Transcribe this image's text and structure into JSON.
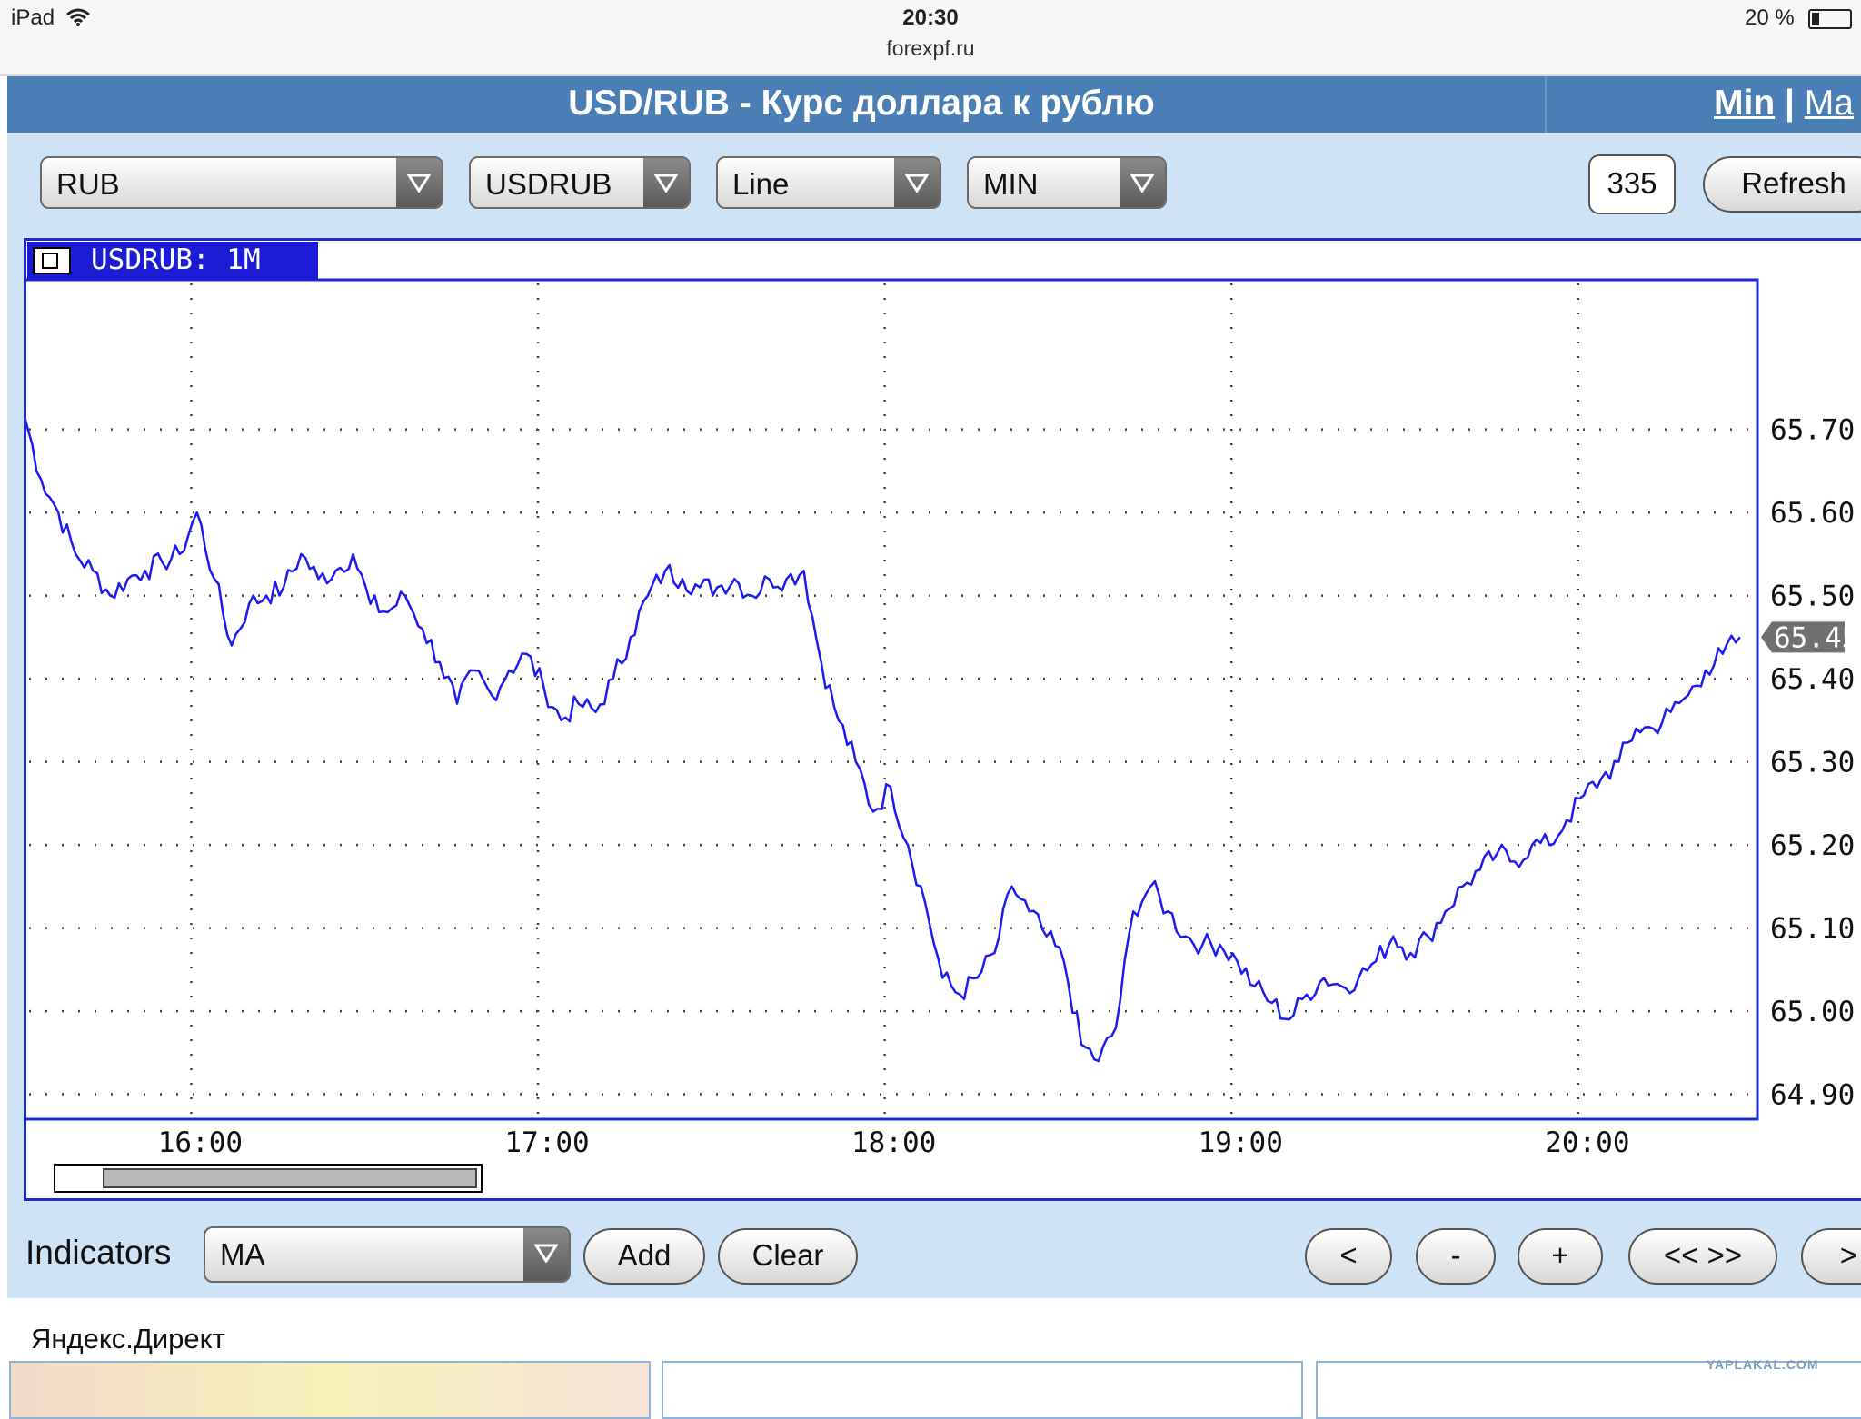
{
  "status_bar": {
    "device": "iPad",
    "time": "20:30",
    "url": "forexpf.ru",
    "battery": "20 %"
  },
  "header": {
    "title": "USD/RUB - Курс доллара к рублю",
    "link_min": "Min",
    "link_sep": " | ",
    "link_max_partial": "Ma"
  },
  "toolbar": {
    "currency_select": "RUB",
    "pair_select": "USDRUB",
    "type_select": "Line",
    "period_select": "MIN",
    "count_value": "335",
    "refresh_label": "Refresh"
  },
  "chart_tab": {
    "label": "USDRUB: 1M"
  },
  "chart_data": {
    "type": "line",
    "title": "USDRUB: 1M",
    "x_ticks": [
      "16:00",
      "17:00",
      "18:00",
      "19:00",
      "20:00"
    ],
    "y_ticks": [
      "64.90",
      "65.00",
      "65.10",
      "65.20",
      "65.30",
      "65.40",
      "65.50",
      "65.60",
      "65.70"
    ],
    "ylim": [
      64.87,
      65.88
    ],
    "xlim": [
      "15:31",
      "20:31"
    ],
    "current_value": "65.45",
    "grid": true,
    "series": [
      {
        "x": [
          "15:31",
          "15:34",
          "15:37",
          "15:40",
          "15:43",
          "15:46",
          "15:49",
          "15:52",
          "15:55",
          "15:58",
          "16:01",
          "16:04",
          "16:07",
          "16:10",
          "16:13",
          "16:16",
          "16:19",
          "16:22",
          "16:25",
          "16:28",
          "16:31",
          "16:34",
          "16:37",
          "16:40",
          "16:43",
          "16:46",
          "16:49",
          "16:52",
          "16:55",
          "16:58",
          "17:01",
          "17:04",
          "17:07",
          "17:10",
          "17:13",
          "17:16",
          "17:19",
          "17:22",
          "17:25",
          "17:28",
          "17:31",
          "17:34",
          "17:37",
          "17:40",
          "17:43",
          "17:46",
          "17:49",
          "17:52",
          "17:55",
          "17:58",
          "18:01",
          "18:04",
          "18:07",
          "18:10",
          "18:13",
          "18:16",
          "18:19",
          "18:22",
          "18:25",
          "18:28",
          "18:31",
          "18:34",
          "18:37",
          "18:40",
          "18:43",
          "18:46",
          "18:49",
          "18:52",
          "18:55",
          "18:58",
          "19:01",
          "19:04",
          "19:07",
          "19:10",
          "19:13",
          "19:16",
          "19:19",
          "19:22",
          "19:25",
          "19:28",
          "19:31",
          "19:34",
          "19:37",
          "19:40",
          "19:43",
          "19:46",
          "19:49",
          "19:52",
          "19:55",
          "19:58",
          "20:01",
          "20:04",
          "20:07",
          "20:10",
          "20:13",
          "20:16",
          "20:19",
          "20:22",
          "20:25",
          "20:28"
        ],
        "y": [
          65.72,
          65.64,
          65.6,
          65.55,
          65.53,
          65.5,
          65.52,
          65.53,
          65.54,
          65.55,
          65.6,
          65.52,
          65.44,
          65.49,
          65.5,
          65.51,
          65.55,
          65.52,
          65.53,
          65.55,
          65.49,
          65.48,
          65.5,
          65.46,
          65.42,
          65.37,
          65.41,
          65.38,
          65.41,
          65.43,
          65.39,
          65.35,
          65.37,
          65.36,
          65.4,
          65.45,
          65.5,
          65.53,
          65.52,
          65.51,
          65.51,
          65.52,
          65.5,
          65.52,
          65.52,
          65.53,
          65.42,
          65.35,
          65.3,
          65.24,
          65.27,
          65.2,
          65.13,
          65.04,
          65.02,
          65.04,
          65.07,
          65.15,
          65.12,
          65.09,
          65.06,
          64.96,
          64.94,
          64.98,
          65.12,
          65.15,
          65.12,
          65.09,
          65.08,
          65.08,
          65.06,
          65.03,
          65.01,
          64.99,
          65.02,
          65.04,
          65.03,
          65.04,
          65.06,
          65.09,
          65.07,
          65.09,
          65.12,
          65.15,
          65.17,
          65.19,
          65.18,
          65.2,
          65.2,
          65.23,
          65.26,
          65.28,
          65.3,
          65.34,
          65.34,
          65.36,
          65.38,
          65.41,
          65.43,
          65.45
        ]
      }
    ]
  },
  "chart_controls": {
    "indicators_label": "Indicators",
    "indicator_select": "MA",
    "add_label": "Add",
    "clear_label": "Clear",
    "prev_label": "<",
    "zoom_out_label": "-",
    "zoom_in_label": "+",
    "fit_label": "<< >>",
    "next_label": ">"
  },
  "footer": {
    "yandex_direct": "Яндекс.Директ",
    "watermark": "YAPLAKAL.COM"
  }
}
